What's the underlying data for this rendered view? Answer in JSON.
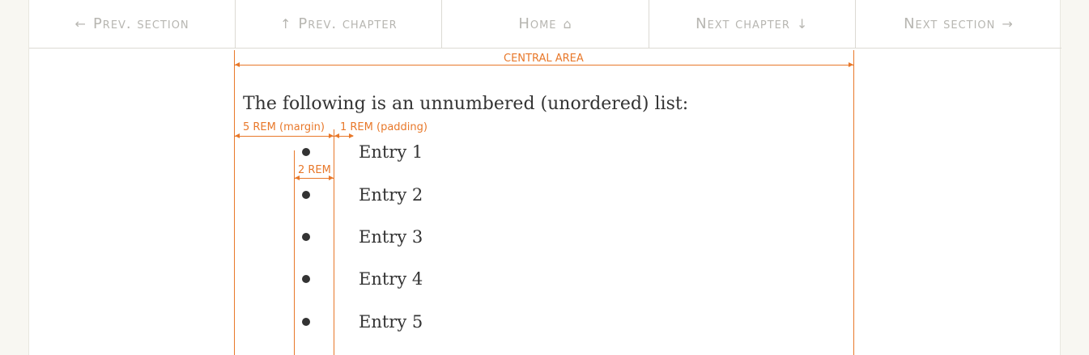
{
  "nav": {
    "items": [
      {
        "label": "Prev. section",
        "icon": "←",
        "icon_name": "arrow-left-icon",
        "icon_pos": "before"
      },
      {
        "label": "Prev. chapter",
        "icon": "↑",
        "icon_name": "arrow-up-icon",
        "icon_pos": "before"
      },
      {
        "label": "Home",
        "icon": "⌂",
        "icon_name": "home-icon",
        "icon_pos": "after"
      },
      {
        "label": "Next chapter",
        "icon": "↓",
        "icon_name": "arrow-down-icon",
        "icon_pos": "after"
      },
      {
        "label": "Next section",
        "icon": "→",
        "icon_name": "arrow-right-icon",
        "icon_pos": "after"
      }
    ]
  },
  "annotations": {
    "central_area": "CENTRAL AREA",
    "margin": "5 REM (margin)",
    "padding": "1 REM (padding)",
    "bullet_width": "2 REM"
  },
  "content": {
    "lead": "The following is an unnumbered (unordered) list:",
    "entries": [
      "Entry 1",
      "Entry 2",
      "Entry 3",
      "Entry 4",
      "Entry 5"
    ]
  },
  "colors": {
    "annotation": "#e8782a",
    "nav_text": "#b7b6b1",
    "body_text": "#333333"
  }
}
